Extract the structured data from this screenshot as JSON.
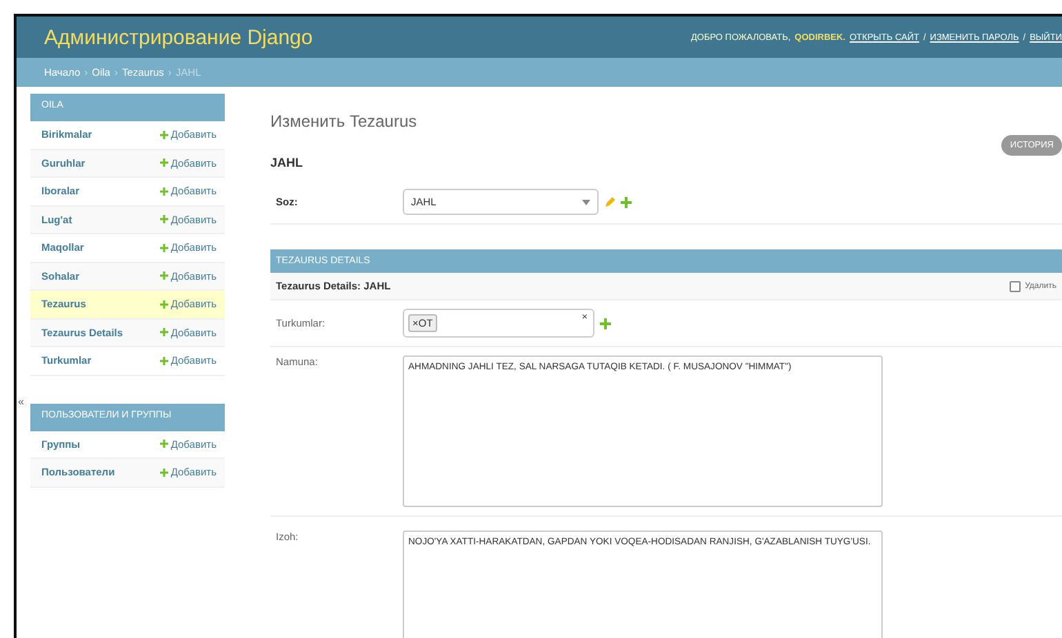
{
  "header": {
    "title": "Администрирование Django",
    "welcome": "ДОБРО ПОЖАЛОВАТЬ,",
    "user": "QODIRBEK.",
    "link_separator": "/",
    "links": [
      "ОТКРЫТЬ САЙТ",
      "ИЗМЕНИТЬ ПАРОЛЬ",
      "ВЫЙТИ"
    ]
  },
  "breadcrumb_separator": "›",
  "breadcrumbs": [
    {
      "label": "Начало",
      "current": false
    },
    {
      "label": "Oila",
      "current": false
    },
    {
      "label": "Tezaurus",
      "current": false
    },
    {
      "label": "JAHL",
      "current": true
    }
  ],
  "sidebar": {
    "collapse_toggle": "«",
    "modules": [
      {
        "caption": "OILA",
        "items": [
          {
            "label": "Birikmalar",
            "add": "Добавить",
            "selected": false
          },
          {
            "label": "Guruhlar",
            "add": "Добавить",
            "selected": false
          },
          {
            "label": "Iboralar",
            "add": "Добавить",
            "selected": false
          },
          {
            "label": "Lug'at",
            "add": "Добавить",
            "selected": false
          },
          {
            "label": "Maqollar",
            "add": "Добавить",
            "selected": false
          },
          {
            "label": "Sohalar",
            "add": "Добавить",
            "selected": false
          },
          {
            "label": "Tezaurus",
            "add": "Добавить",
            "selected": true
          },
          {
            "label": "Tezaurus Details",
            "add": "Добавить",
            "selected": false
          },
          {
            "label": "Turkumlar",
            "add": "Добавить",
            "selected": false
          }
        ]
      },
      {
        "caption": "ПОЛЬЗОВАТЕЛИ И ГРУППЫ",
        "items": [
          {
            "label": "Группы",
            "add": "Добавить",
            "selected": false
          },
          {
            "label": "Пользователи",
            "add": "Добавить",
            "selected": false
          }
        ]
      }
    ]
  },
  "content": {
    "title": "Изменить Tezaurus",
    "history_button": "ИСТОРИЯ",
    "object_name": "JAHL",
    "soz": {
      "label": "Soz:",
      "value": "JAHL"
    },
    "inline": {
      "caption": "TEZAURUS DETAILS",
      "row_title": "Tezaurus Details: JAHL",
      "delete_label": "Удалить",
      "delete_checked": false,
      "turkumlar": {
        "label": "Turkumlar:",
        "tags": [
          "OT"
        ],
        "tag_remove": "×",
        "clear": "×"
      },
      "namuna": {
        "label": "Namuna:",
        "value": "AHMADNING JAHLI TEZ, SAL NARSAGA TUTAQIB KETADI. ( F. MUSAJONOV \"HIMMAT\")"
      },
      "izoh": {
        "label": "Izoh:",
        "value": "NOJO'YA XATTI-HARAKATDAN, GAPDAN YOKI VOQEA-HODISADAN RANJISH, G'AZABLANISH TUYG'USI."
      }
    }
  }
}
